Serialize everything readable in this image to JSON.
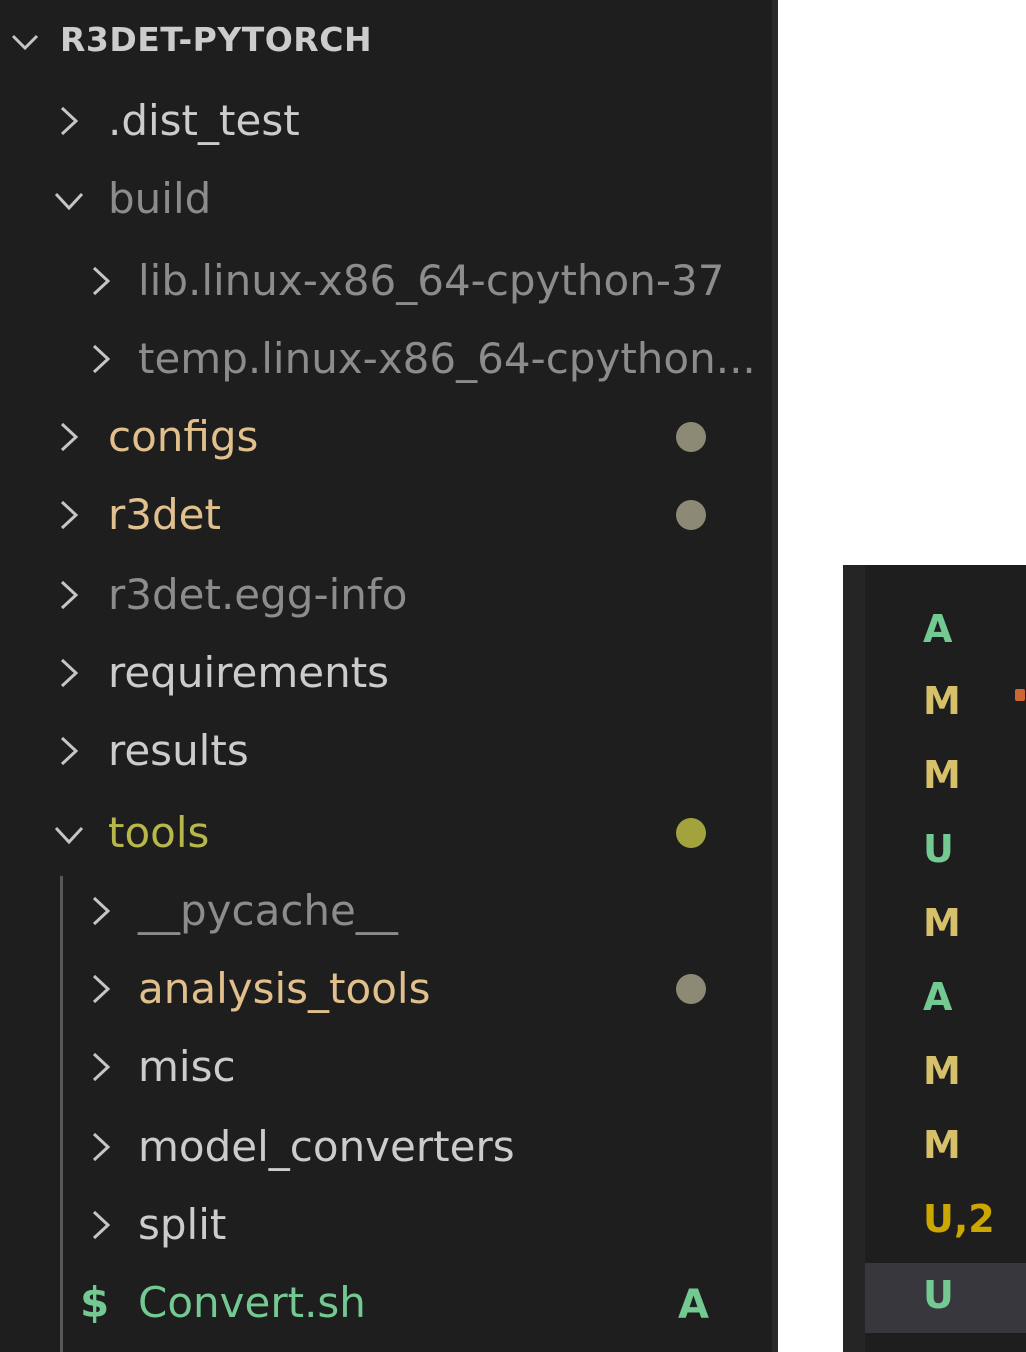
{
  "explorer": {
    "title": "R3DET-PYTORCH",
    "rows": [
      {
        "label": ".dist_test",
        "expanded": false,
        "color": "#cccccc"
      },
      {
        "label": "build",
        "expanded": true,
        "color": "#8c8c8c"
      },
      {
        "label": "lib.linux-x86_64-cpython-37",
        "expanded": false,
        "color": "#8c8c8c"
      },
      {
        "label": "temp.linux-x86_64-cpython...",
        "expanded": false,
        "color": "#8c8c8c"
      },
      {
        "label": "configs",
        "expanded": false,
        "color": "#e2c08d"
      },
      {
        "label": "r3det",
        "expanded": false,
        "color": "#e2c08d"
      },
      {
        "label": "r3det.egg-info",
        "expanded": false,
        "color": "#8c8c8c"
      },
      {
        "label": "requirements",
        "expanded": false,
        "color": "#cccccc"
      },
      {
        "label": "results",
        "expanded": false,
        "color": "#cccccc"
      },
      {
        "label": "tools",
        "expanded": true,
        "color": "#b8b84a"
      },
      {
        "label": "__pycache__",
        "expanded": false,
        "color": "#8c8c8c"
      },
      {
        "label": "analysis_tools",
        "expanded": false,
        "color": "#e2c08d"
      },
      {
        "label": "misc",
        "expanded": false,
        "color": "#cccccc"
      },
      {
        "label": "model_converters",
        "expanded": false,
        "color": "#cccccc"
      },
      {
        "label": "split",
        "expanded": false,
        "color": "#cccccc"
      },
      {
        "label": "Convert.sh",
        "file_icon": "$",
        "color": "#73c991",
        "status": "A"
      }
    ],
    "modified_dot_color": "#8c8a75",
    "tools_dot_color": "#a3a33d"
  },
  "source_control": {
    "statuses": [
      {
        "text": "A",
        "color": "#73c991"
      },
      {
        "text": "M",
        "color": "#d7c06a"
      },
      {
        "text": "M",
        "color": "#d7c06a"
      },
      {
        "text": "U",
        "color": "#73c991"
      },
      {
        "text": "M",
        "color": "#d7c06a"
      },
      {
        "text": "A",
        "color": "#73c991"
      },
      {
        "text": "M",
        "color": "#d7c06a"
      },
      {
        "text": "M",
        "color": "#d7c06a"
      },
      {
        "text": "U,2",
        "color": "#cca700"
      },
      {
        "text": "U",
        "color": "#73c991"
      }
    ]
  }
}
